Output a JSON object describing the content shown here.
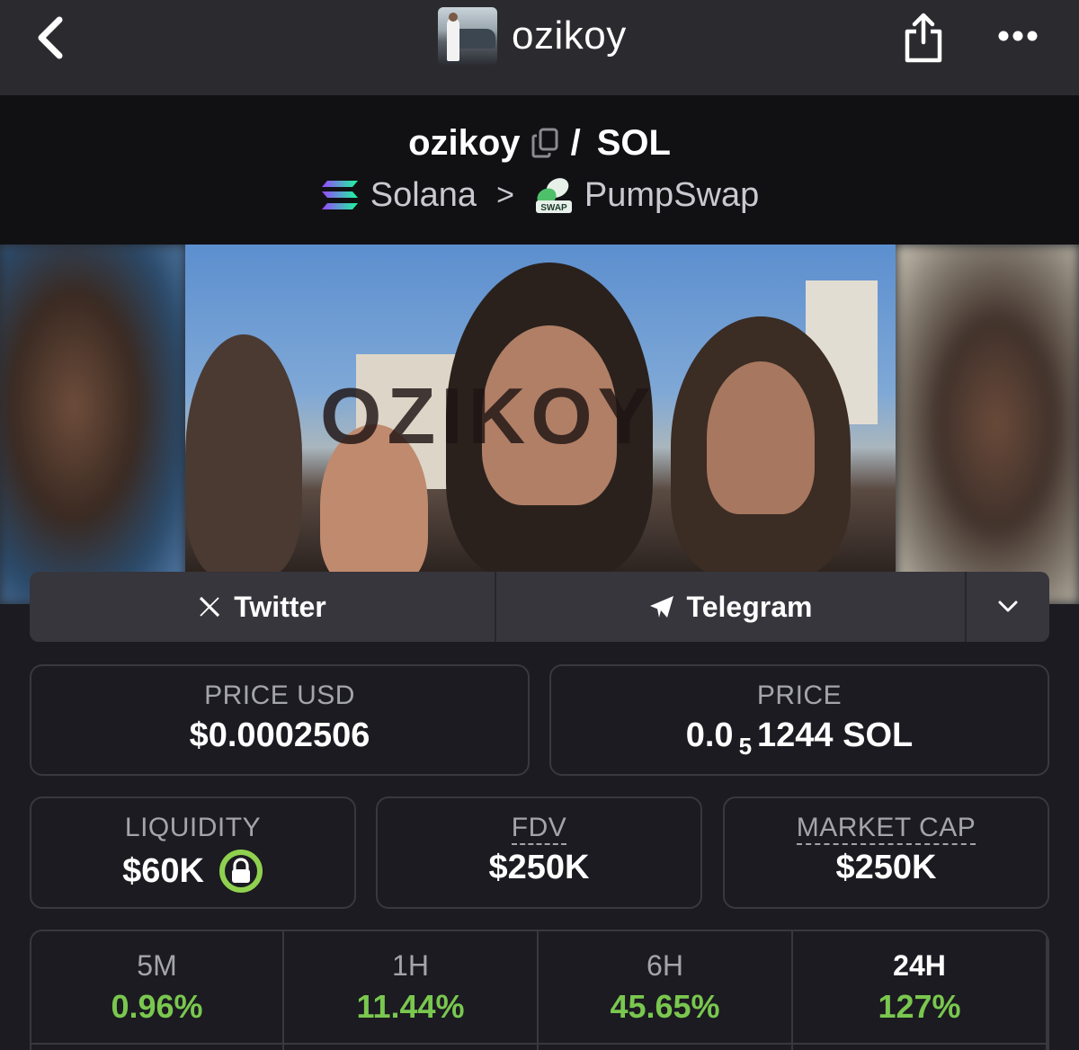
{
  "nav": {
    "title": "ozikoy",
    "icons": {
      "back": "chevron-left-icon",
      "share": "share-icon",
      "more": "more-dots-icon"
    }
  },
  "pair": {
    "token": "ozikoy",
    "separator": "/",
    "quote": "SOL",
    "chain": "Solana",
    "dex": "PumpSwap",
    "chevron": ">"
  },
  "banner": {
    "text": "OZIKOY"
  },
  "links": {
    "twitter": "Twitter",
    "telegram": "Telegram"
  },
  "stats": {
    "price_usd_label": "PRICE USD",
    "price_usd_value": "$0.0002506",
    "price_label": "PRICE",
    "price_prefix": "0.0",
    "price_sub": "5",
    "price_suffix": "1244 SOL",
    "liquidity_label": "LIQUIDITY",
    "liquidity_value": "$60K",
    "fdv_label": "FDV",
    "fdv_value": "$250K",
    "mcap_label": "MARKET CAP",
    "mcap_value": "$250K"
  },
  "timeframes": [
    {
      "label": "5M",
      "change": "0.96%"
    },
    {
      "label": "1H",
      "change": "11.44%"
    },
    {
      "label": "6H",
      "change": "45.65%"
    },
    {
      "label": "24H",
      "change": "127%"
    }
  ],
  "colors": {
    "positive": "#7ac74f",
    "lock_ring": "#8fd14f",
    "topbar": "#2b2b2f",
    "header": "#111114",
    "background": "#1b1b21"
  }
}
